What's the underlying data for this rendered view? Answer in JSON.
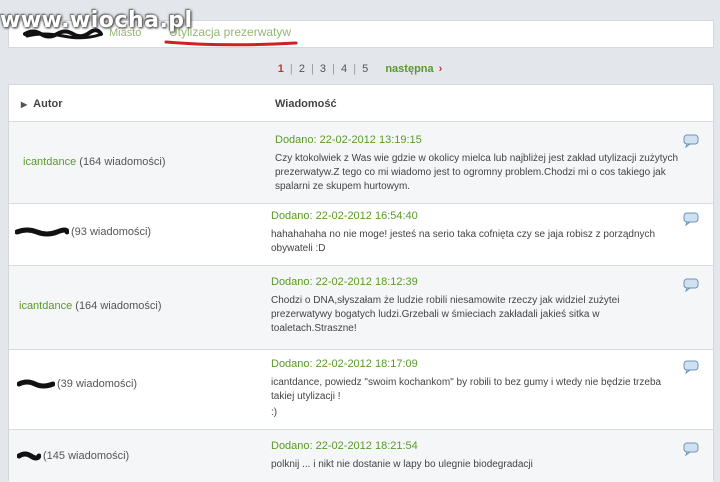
{
  "watermark": "www.wiocha.pl",
  "breadcrumb": {
    "parent": "Miasto",
    "current": "Utylizacja prezerwatyw"
  },
  "pagination": {
    "current": "1",
    "pages": [
      "2",
      "3",
      "4",
      "5"
    ],
    "next_label": "następna",
    "next_chevron": "›"
  },
  "table": {
    "col_author": "Autor",
    "col_message": "Wiadomość"
  },
  "posts": [
    {
      "author_nick": "icantdance",
      "author_count": "(164 wiadomości)",
      "date": "Dodano: 22-02-2012 13:19:15",
      "text": "Czy ktokolwiek z Was wie gdzie w okolicy mielca lub najbliżej jest zakład utylizacji zużytych prezerwatyw.Z tego co mi wiadomo jest to ogromny problem.Chodzi mi o cos takiego jak spalarni ze skupem hurtowym."
    },
    {
      "author_nick": "",
      "author_count": "(93 wiadomości)",
      "date": "Dodano: 22-02-2012 16:54:40",
      "text": "hahahahaha no nie moge! jesteś na serio taka cofnięta czy se jaja robisz z porządnych obywateli :D"
    },
    {
      "author_nick": "icantdance",
      "author_count": "(164 wiadomości)",
      "date": "Dodano: 22-02-2012 18:12:39",
      "text": "Chodzi o DNA,słyszałam że ludzie robili niesamowite rzeczy jak widziel zużytei prezerwatywy bogatych ludzi.Grzebali w śmieciach zakładali jakieś sitka w toaletach.Straszne!"
    },
    {
      "author_nick": "",
      "author_count": "(39 wiadomości)",
      "date": "Dodano: 22-02-2012 18:17:09",
      "text": "icantdance, powiedz \"swoim kochankom\" by robili to bez gumy i wtedy nie będzie trzeba takiej utylizacji !",
      "text2": ":)"
    },
    {
      "author_nick": "",
      "author_count": "(145 wiadomości)",
      "date": "Dodano: 22-02-2012 18:21:54",
      "text": "polknij ... i nikt nie dostanie w lapy bo ulegnie biodegradacji"
    }
  ],
  "colors": {
    "accent_green": "#5a9a28",
    "page_red": "#c0392b",
    "underline_red": "#cc2222"
  },
  "icons": {
    "reply": "speech-bubble-icon",
    "sort": "triangle-right-icon"
  }
}
